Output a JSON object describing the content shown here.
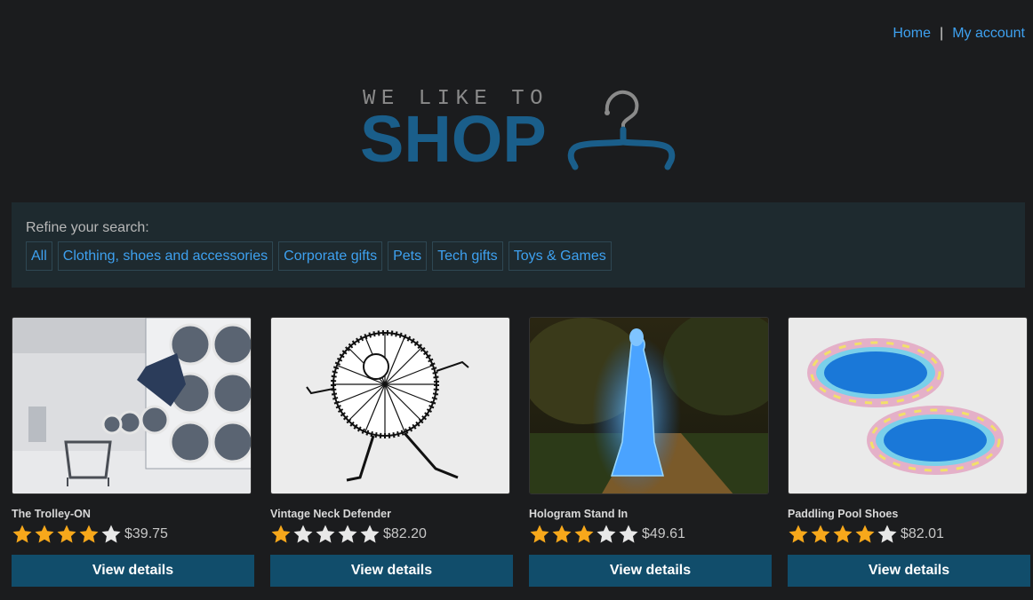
{
  "nav": {
    "home": "Home",
    "separator": "|",
    "account": "My account"
  },
  "logo": {
    "tagline": "WE LIKE TO",
    "word": "SHOP",
    "icon": "hanger-icon"
  },
  "filters": {
    "title": "Refine your search:",
    "categories": [
      "All",
      "Clothing, shoes and accessories",
      "Corporate gifts",
      "Pets",
      "Tech gifts",
      "Toys & Games"
    ]
  },
  "products": [
    {
      "name": "The Trolley-ON",
      "rating": 4,
      "price": "$39.75",
      "button": "View details"
    },
    {
      "name": "Vintage Neck Defender",
      "rating": 1,
      "price": "$82.20",
      "button": "View details"
    },
    {
      "name": "Hologram Stand In",
      "rating": 3,
      "price": "$49.61",
      "button": "View details"
    },
    {
      "name": "Paddling Pool Shoes",
      "rating": 4,
      "price": "$82.01",
      "button": "View details"
    }
  ],
  "colors": {
    "accent": "#3ea1f0",
    "button": "#114d6b",
    "star_on": "#f7a81b",
    "star_off": "#e8e8e8"
  }
}
